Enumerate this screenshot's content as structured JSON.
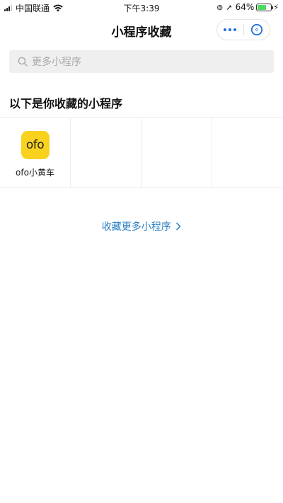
{
  "status_bar": {
    "carrier": "中国联通",
    "time": "下午3:39",
    "battery_percent": "64%",
    "battery_level": 0.64,
    "battery_color": "#4cd964"
  },
  "nav": {
    "title": "小程序收藏",
    "more_icon": "more-dots-icon",
    "close_icon": "close-circle-icon"
  },
  "search": {
    "placeholder": "更多小程序",
    "icon": "search-icon"
  },
  "section": {
    "title": "以下是你收藏的小程序"
  },
  "favorites": [
    {
      "name": "ofo小黄车",
      "logo_text": "ofo",
      "icon_color": "#f9d21e"
    }
  ],
  "footer_link": {
    "label": "收藏更多小程序",
    "chevron": "chevron-right-icon",
    "color": "#2a7fc4"
  }
}
